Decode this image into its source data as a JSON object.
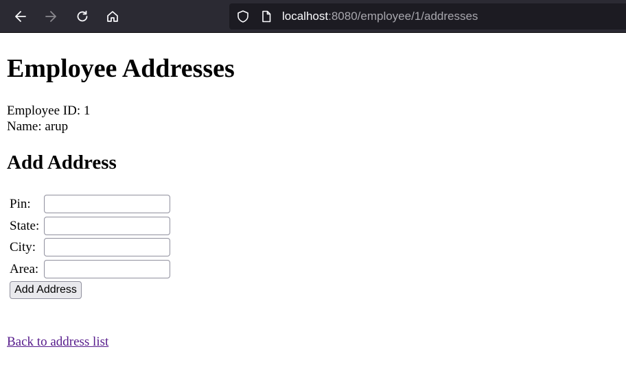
{
  "browser": {
    "url_host": "localhost",
    "url_rest": ":8080/employee/1/addresses",
    "icons": {
      "back": "back-arrow-icon",
      "forward": "forward-arrow-icon",
      "reload": "reload-icon",
      "home": "home-icon",
      "shield": "shield-icon",
      "page": "page-icon"
    },
    "forward_disabled": true
  },
  "page": {
    "title": "Employee Addresses",
    "employee_id_line": "Employee ID: 1",
    "name_line": "Name: arup",
    "form_heading": "Add Address",
    "fields": [
      {
        "label": "Pin:",
        "value": "",
        "placeholder": ""
      },
      {
        "label": "State:",
        "value": "",
        "placeholder": ""
      },
      {
        "label": "City:",
        "value": "",
        "placeholder": ""
      },
      {
        "label": "Area:",
        "value": "",
        "placeholder": ""
      }
    ],
    "submit_label": "Add Address",
    "back_link": "Back to address list"
  },
  "colors": {
    "toolbar_bg": "#2b2a33",
    "urlbar_bg": "#1c1b22",
    "visited_link": "#551a8b"
  }
}
